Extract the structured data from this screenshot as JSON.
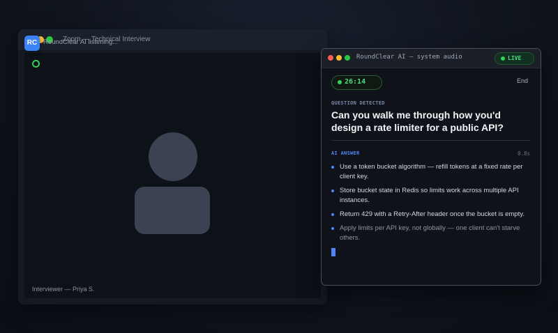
{
  "zoom": {
    "title": "Zoom — Technical Interview",
    "participant_label": "Interviewer — Priya S."
  },
  "overlay": {
    "badge": "RC",
    "status": "RoundClear AI listening..."
  },
  "panel": {
    "title": "RoundClear AI — system audio",
    "live_label": "LIVE",
    "timer": "26:14",
    "end_label": "End",
    "question_label": "QUESTION DETECTED",
    "question": "Can you walk me through how you'd design a rate limiter for a public API?",
    "answer_label": "AI ANSWER",
    "latency": "0.8s",
    "answers": [
      "Use a token bucket algorithm — refill tokens at a fixed rate per client key.",
      "Store bucket state in Redis so limits work across multiple API instances.",
      "Return 429 with a Retry-After header once the bucket is empty.",
      "Apply limits per API key, not globally — one client can't starve others."
    ]
  },
  "colors": {
    "accent": "#4f86f7",
    "live_green": "#4ade80",
    "badge_blue": "#3b82f6"
  },
  "icons": {
    "avatar": "person-silhouette-icon",
    "status": "status-ring-icon"
  }
}
